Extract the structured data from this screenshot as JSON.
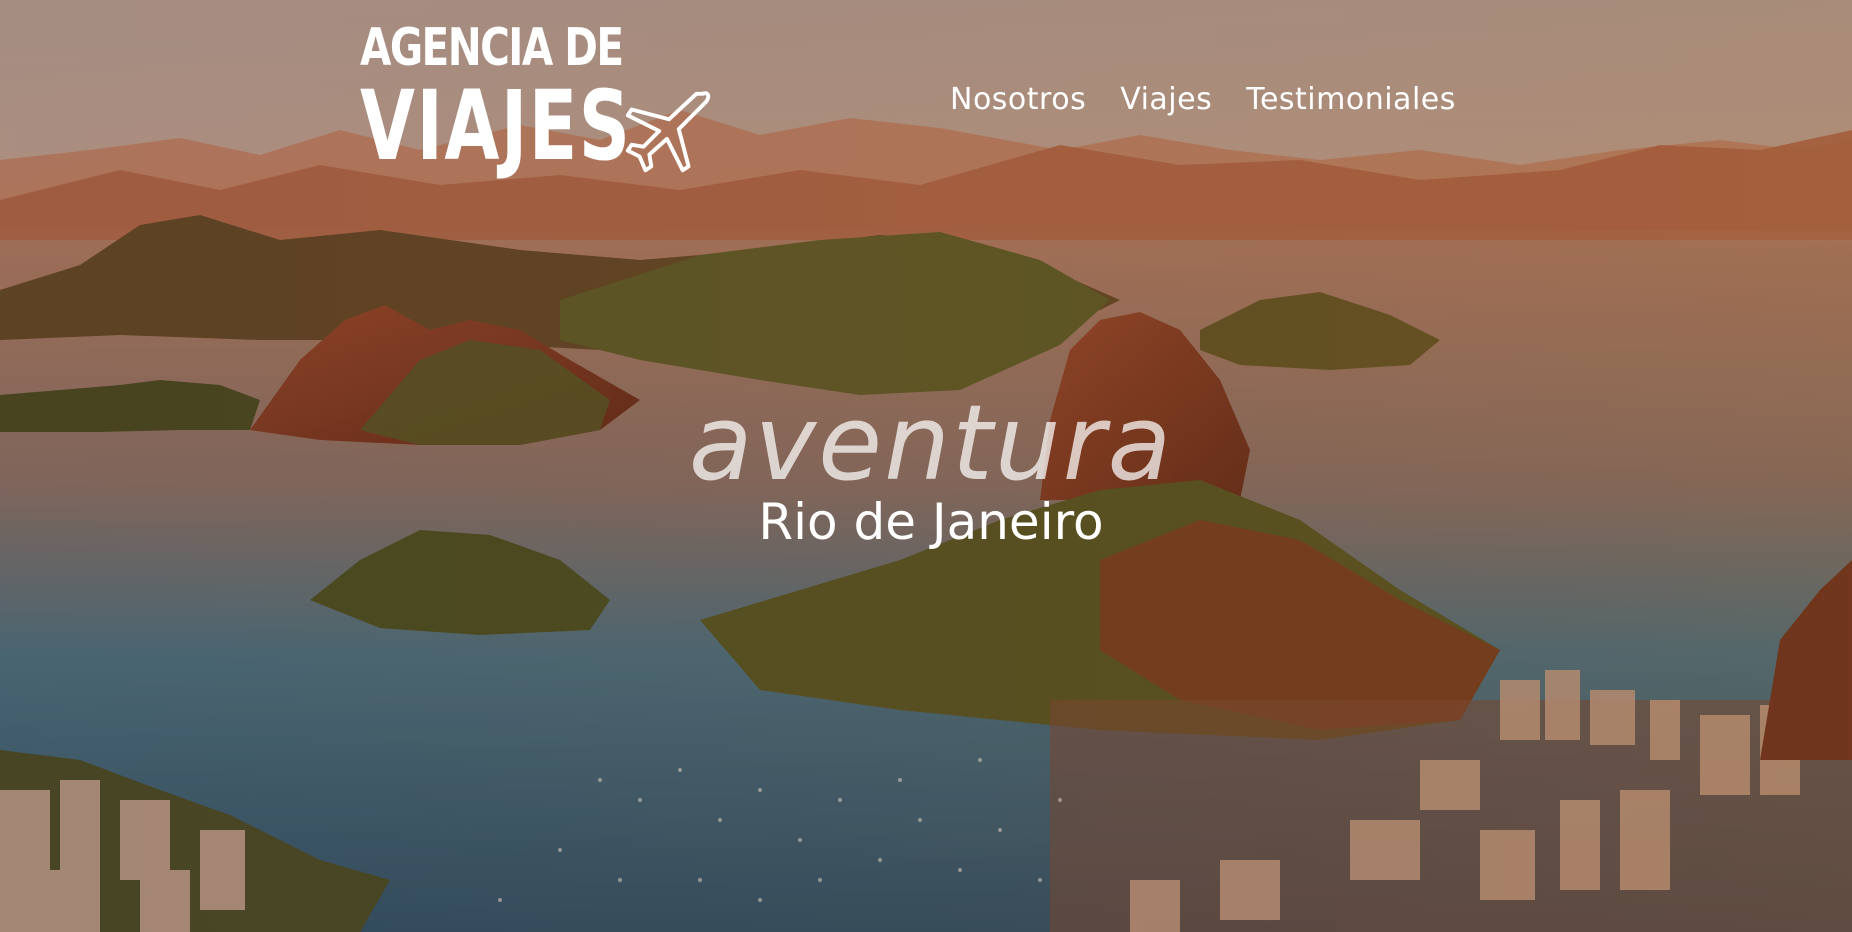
{
  "header": {
    "logo": {
      "line1": "AGENCIA DE",
      "line2": "VIAJES",
      "icon": "airplane-icon"
    },
    "nav": [
      {
        "label": "Nosotros"
      },
      {
        "label": "Viajes"
      },
      {
        "label": "Testimoniales"
      }
    ]
  },
  "hero": {
    "headline": "aventura",
    "location": "Rio de Janeiro"
  },
  "colors": {
    "sky": "#d9c4b4",
    "haze": "#e7b08c",
    "mountain_far": "#b86f4e",
    "hill_green": "#4a5a26",
    "rock": "#8a3d22",
    "water": "#2b6c8a",
    "text": "#ffffff"
  }
}
